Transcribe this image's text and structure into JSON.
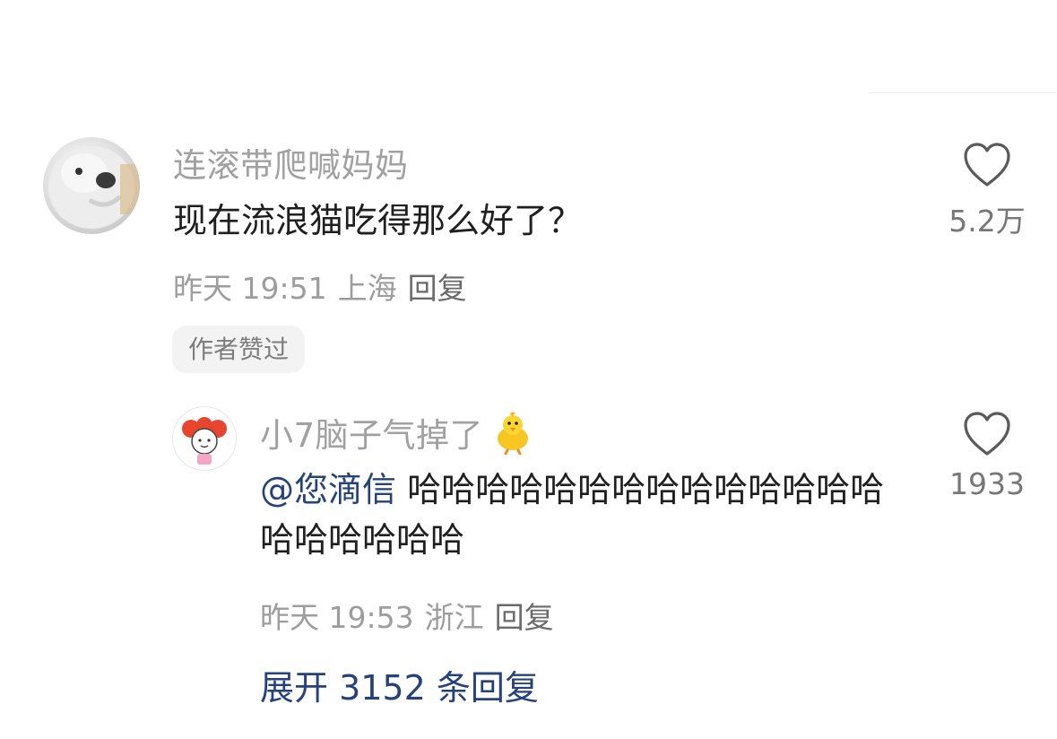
{
  "comments": [
    {
      "username": "连滚带爬喊妈妈",
      "text": "现在流浪猫吃得那么好了？",
      "time": "昨天 19:51",
      "location": "上海",
      "reply_label": "回复",
      "badge": "作者赞过",
      "likes": "5.2万"
    }
  ],
  "reply": {
    "username": "小7脑子气掉了",
    "emoji_icon": "chick-icon",
    "mention": "@您滴信",
    "text": "哈哈哈哈哈哈哈哈哈哈哈哈哈哈哈哈哈哈哈哈",
    "time": "昨天 19:53",
    "location": "浙江",
    "reply_label": "回复",
    "likes": "1933"
  },
  "expand_replies_label": "展开 3152 条回复",
  "colors": {
    "username": "#a1a1a1",
    "mention": "#25437a",
    "meta": "#9d9d9d",
    "badge_bg": "#f3f3f3"
  }
}
